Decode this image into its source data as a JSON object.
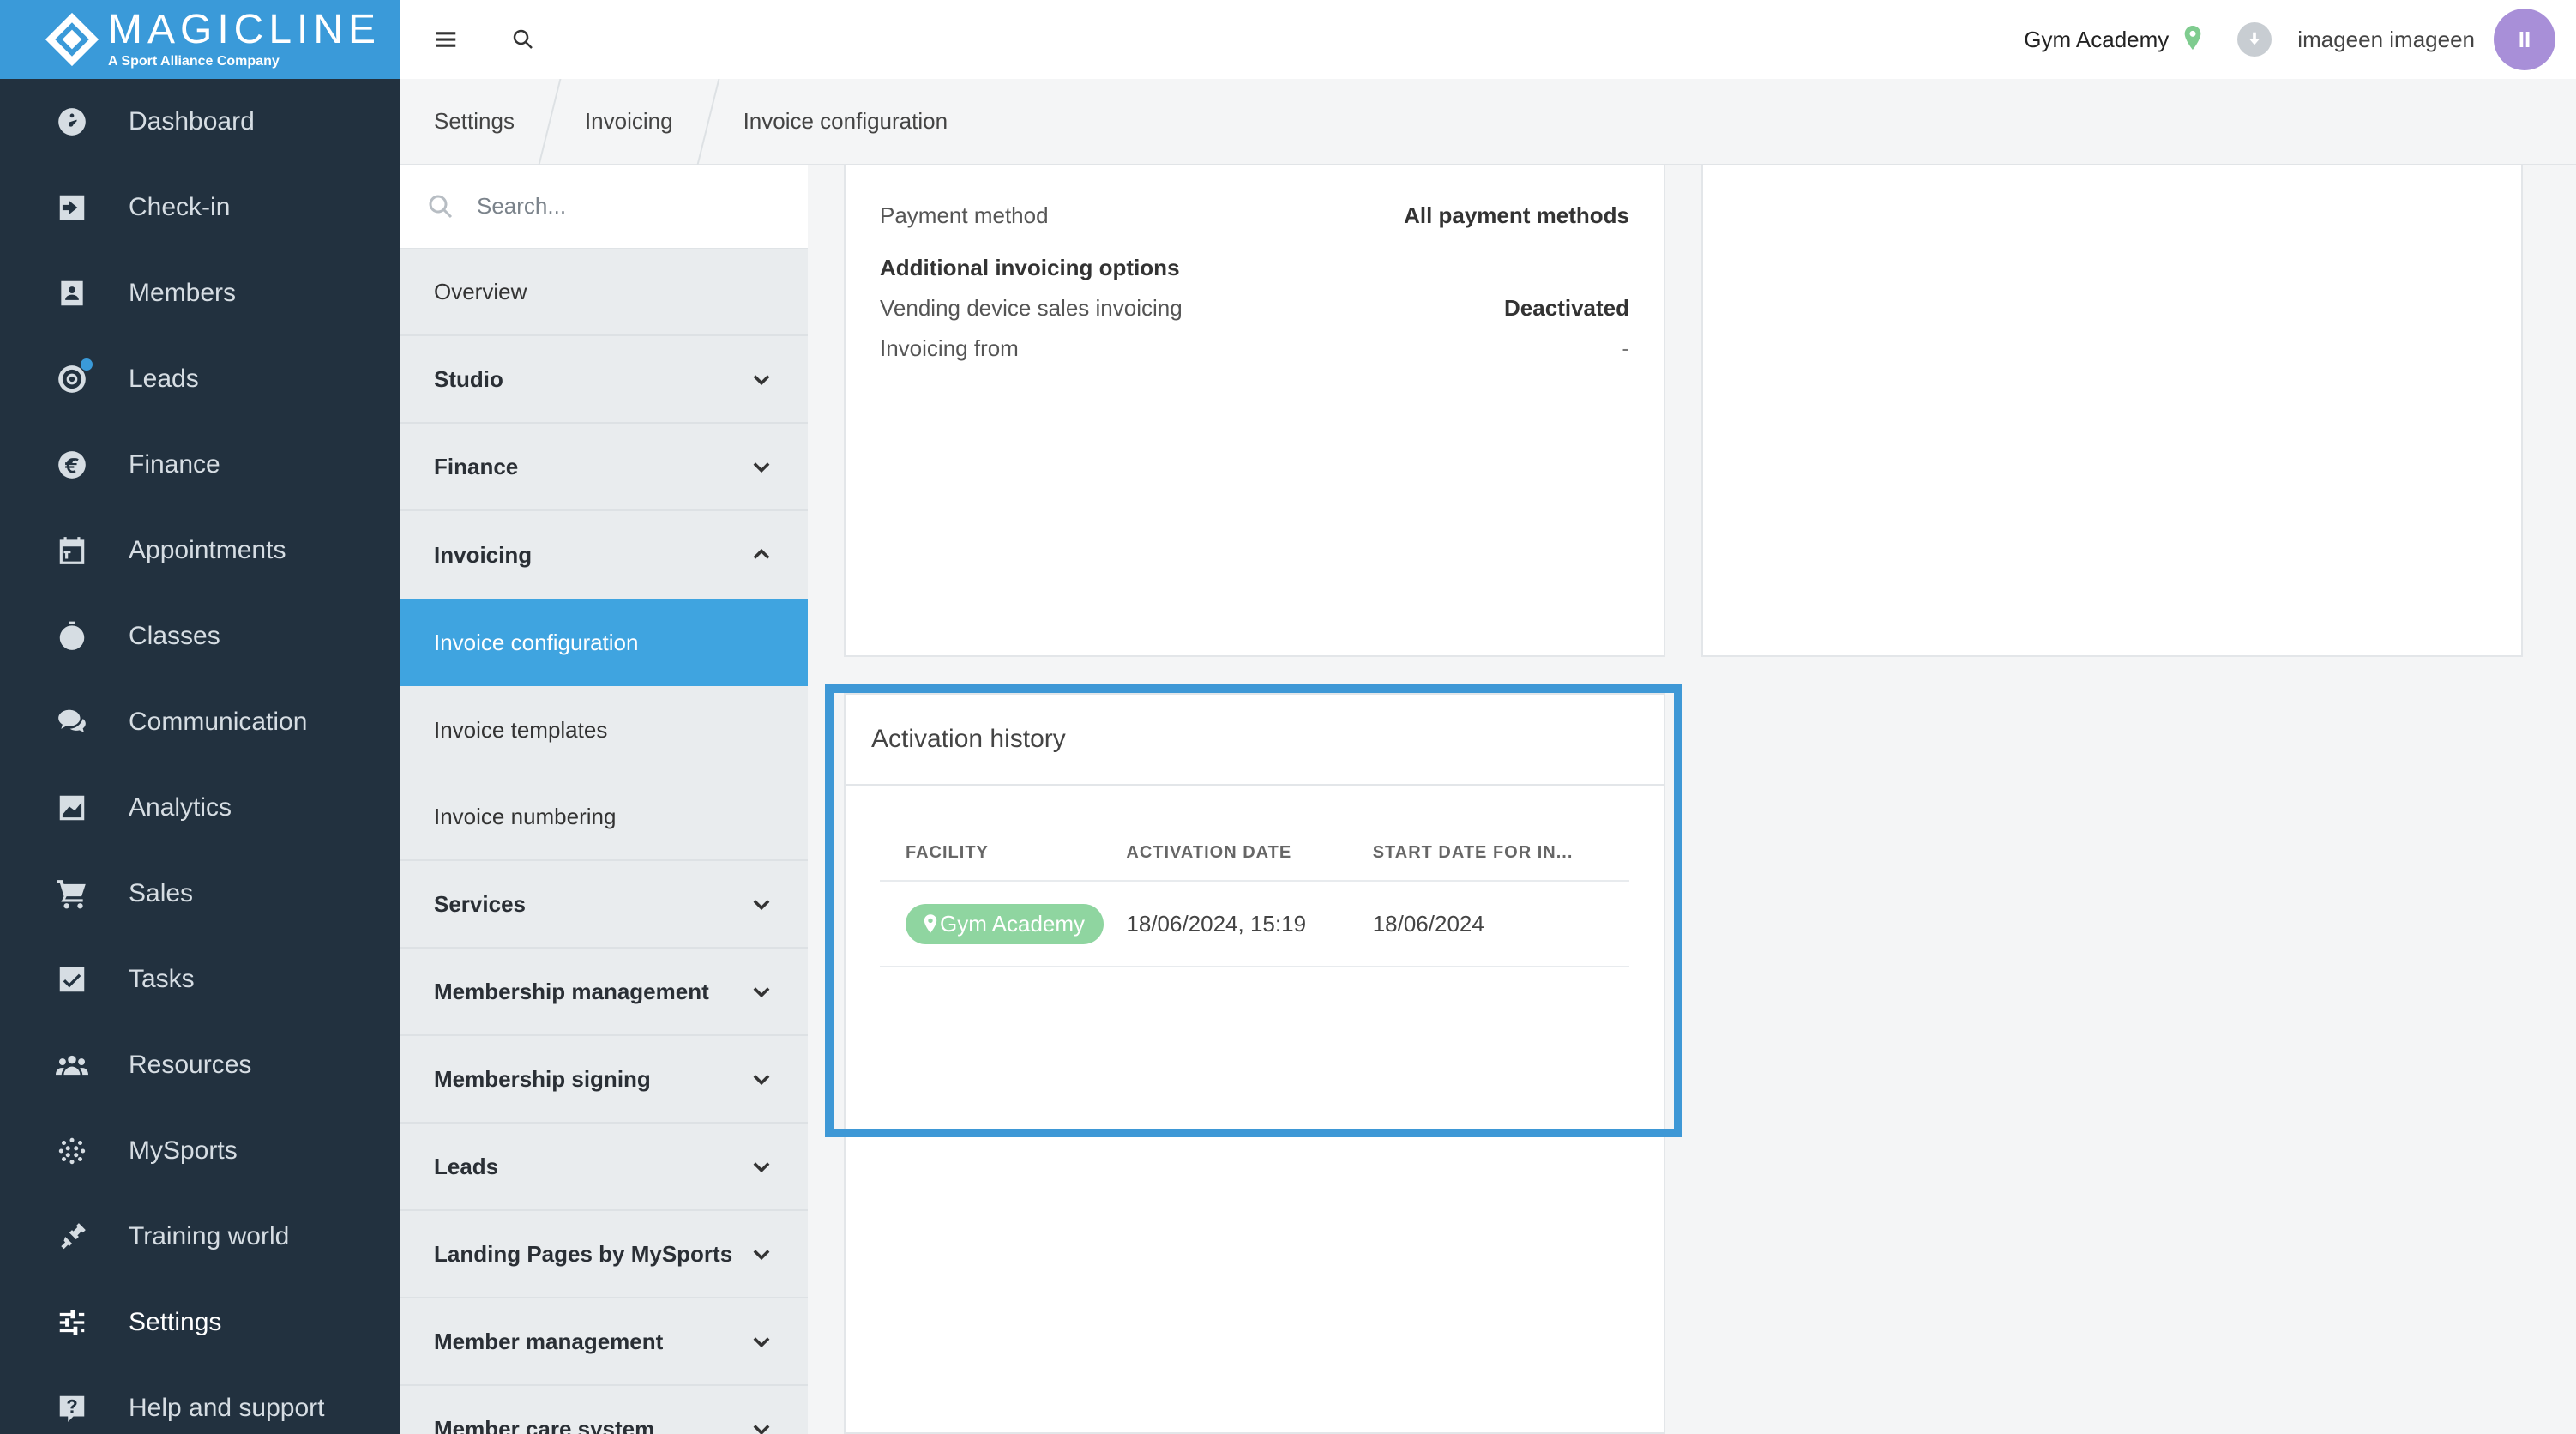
{
  "brand": {
    "name": "MAGICLINE",
    "tagline": "A Sport Alliance Company"
  },
  "nav": {
    "items": [
      {
        "label": "Dashboard",
        "icon": "dashboard-icon"
      },
      {
        "label": "Check-in",
        "icon": "check-in-icon"
      },
      {
        "label": "Members",
        "icon": "members-icon"
      },
      {
        "label": "Leads",
        "icon": "leads-icon"
      },
      {
        "label": "Finance",
        "icon": "euro-icon"
      },
      {
        "label": "Appointments",
        "icon": "calendar-icon"
      },
      {
        "label": "Classes",
        "icon": "stopwatch-icon"
      },
      {
        "label": "Communication",
        "icon": "chat-icon"
      },
      {
        "label": "Analytics",
        "icon": "chart-icon"
      },
      {
        "label": "Sales",
        "icon": "cart-icon"
      },
      {
        "label": "Tasks",
        "icon": "checkbox-icon"
      },
      {
        "label": "Resources",
        "icon": "people-icon"
      },
      {
        "label": "MySports",
        "icon": "dots-grid-icon"
      },
      {
        "label": "Training world",
        "icon": "dumbbell-icon"
      },
      {
        "label": "Settings",
        "icon": "sliders-icon"
      },
      {
        "label": "Help and support",
        "icon": "help-icon"
      }
    ],
    "active": "Settings"
  },
  "topbar": {
    "facility": "Gym Academy",
    "user": "imageen imageen",
    "avatar_initials": "II"
  },
  "breadcrumb": [
    "Settings",
    "Invoicing",
    "Invoice configuration"
  ],
  "submenu": {
    "search_placeholder": "Search...",
    "overview": "Overview",
    "studio": "Studio",
    "finance": "Finance",
    "invoicing": "Invoicing",
    "invoice_configuration": "Invoice configuration",
    "invoice_templates": "Invoice templates",
    "invoice_numbering": "Invoice numbering",
    "services": "Services",
    "membership_management": "Membership management",
    "membership_signing": "Membership signing",
    "leads": "Leads",
    "landing_pages": "Landing Pages by MySports",
    "member_management": "Member management",
    "member_care_system": "Member care system"
  },
  "config": {
    "payment_method_label": "Payment method",
    "payment_method_value": "All payment methods",
    "additional_heading": "Additional invoicing options",
    "vending_label": "Vending device sales invoicing",
    "vending_value": "Deactivated",
    "invoicing_from_label": "Invoicing from",
    "invoicing_from_value": "-"
  },
  "history": {
    "title": "Activation history",
    "columns": [
      "FACILITY",
      "ACTIVATION DATE",
      "START DATE FOR IN..."
    ],
    "rows": [
      {
        "facility": "Gym Academy",
        "activation_date": "18/06/2024, 15:19",
        "start_date": "18/06/2024"
      }
    ]
  },
  "colors": {
    "nav_bg": "#22313f",
    "brand_bg": "#3a9ad9",
    "active_submenu": "#3fa4e0",
    "highlight": "#3e98d6",
    "pill": "#8fd5a0",
    "avatar": "#a88fd8"
  }
}
